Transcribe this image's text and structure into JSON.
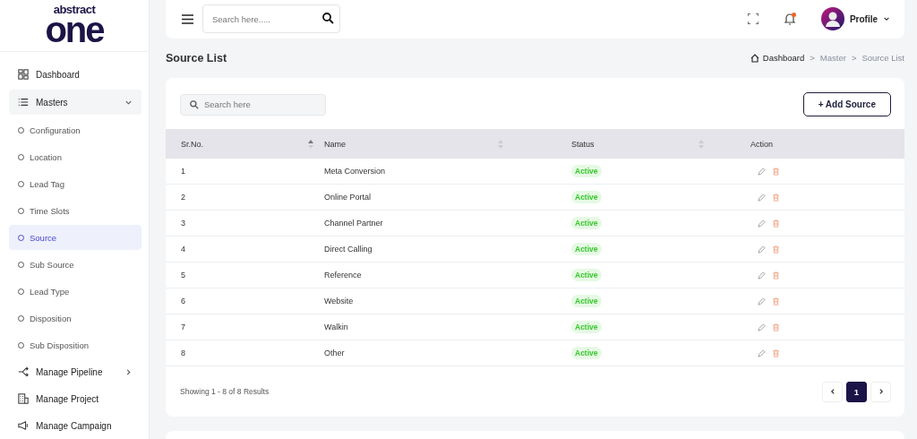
{
  "logo": {
    "top": "abstract",
    "main": "one"
  },
  "sidebar": {
    "items": [
      {
        "label": "Dashboard",
        "kind": "link",
        "selected": false
      },
      {
        "label": "Masters",
        "kind": "group",
        "expanded": true,
        "children": [
          {
            "label": "Configuration",
            "selected": false
          },
          {
            "label": "Location",
            "selected": false
          },
          {
            "label": "Lead Tag",
            "selected": false
          },
          {
            "label": "Time Slots",
            "selected": false
          },
          {
            "label": "Source",
            "selected": true
          },
          {
            "label": "Sub Source",
            "selected": false
          },
          {
            "label": "Lead Type",
            "selected": false
          },
          {
            "label": "Disposition",
            "selected": false
          },
          {
            "label": "Sub Disposition",
            "selected": false
          }
        ]
      },
      {
        "label": "Manage Pipeline",
        "kind": "group",
        "expanded": false
      },
      {
        "label": "Manage Project",
        "kind": "link",
        "selected": false
      },
      {
        "label": "Manage Campaign",
        "kind": "link",
        "selected": false
      }
    ]
  },
  "topbar": {
    "search": {
      "placeholder": "Search here....."
    },
    "notification_dot": true,
    "profile": "Profile"
  },
  "page_title": "Source List",
  "breadcrumb": {
    "items": [
      "Dashboard",
      "Master",
      "Source List"
    ],
    "separator": ">"
  },
  "toolbar": {
    "search": {
      "placeholder": "Search here"
    },
    "add_button": "+ Add Source"
  },
  "table": {
    "columns": [
      {
        "label": "Sr.No.",
        "kind": "sortable",
        "sorted": true
      },
      {
        "label": "Name",
        "kind": "sortable",
        "sorted": false
      },
      {
        "label": "Status",
        "kind": "sortable",
        "sorted": false
      },
      {
        "label": "Action",
        "kind": "plain"
      }
    ],
    "rows": [
      {
        "no": "1",
        "name": "Meta Conversion",
        "status": "Active"
      },
      {
        "no": "2",
        "name": "Online Portal",
        "status": "Active"
      },
      {
        "no": "3",
        "name": "Channel Partner",
        "status": "Active"
      },
      {
        "no": "4",
        "name": "Direct Calling",
        "status": "Active"
      },
      {
        "no": "5",
        "name": "Reference",
        "status": "Active"
      },
      {
        "no": "6",
        "name": "Website",
        "status": "Active"
      },
      {
        "no": "7",
        "name": "Walkin",
        "status": "Active"
      },
      {
        "no": "8",
        "name": "Other",
        "status": "Active"
      }
    ]
  },
  "footer": {
    "summary": "Showing 1 - 8 of 8 Results",
    "pages": [
      {
        "label": "1",
        "selected": true
      }
    ]
  }
}
